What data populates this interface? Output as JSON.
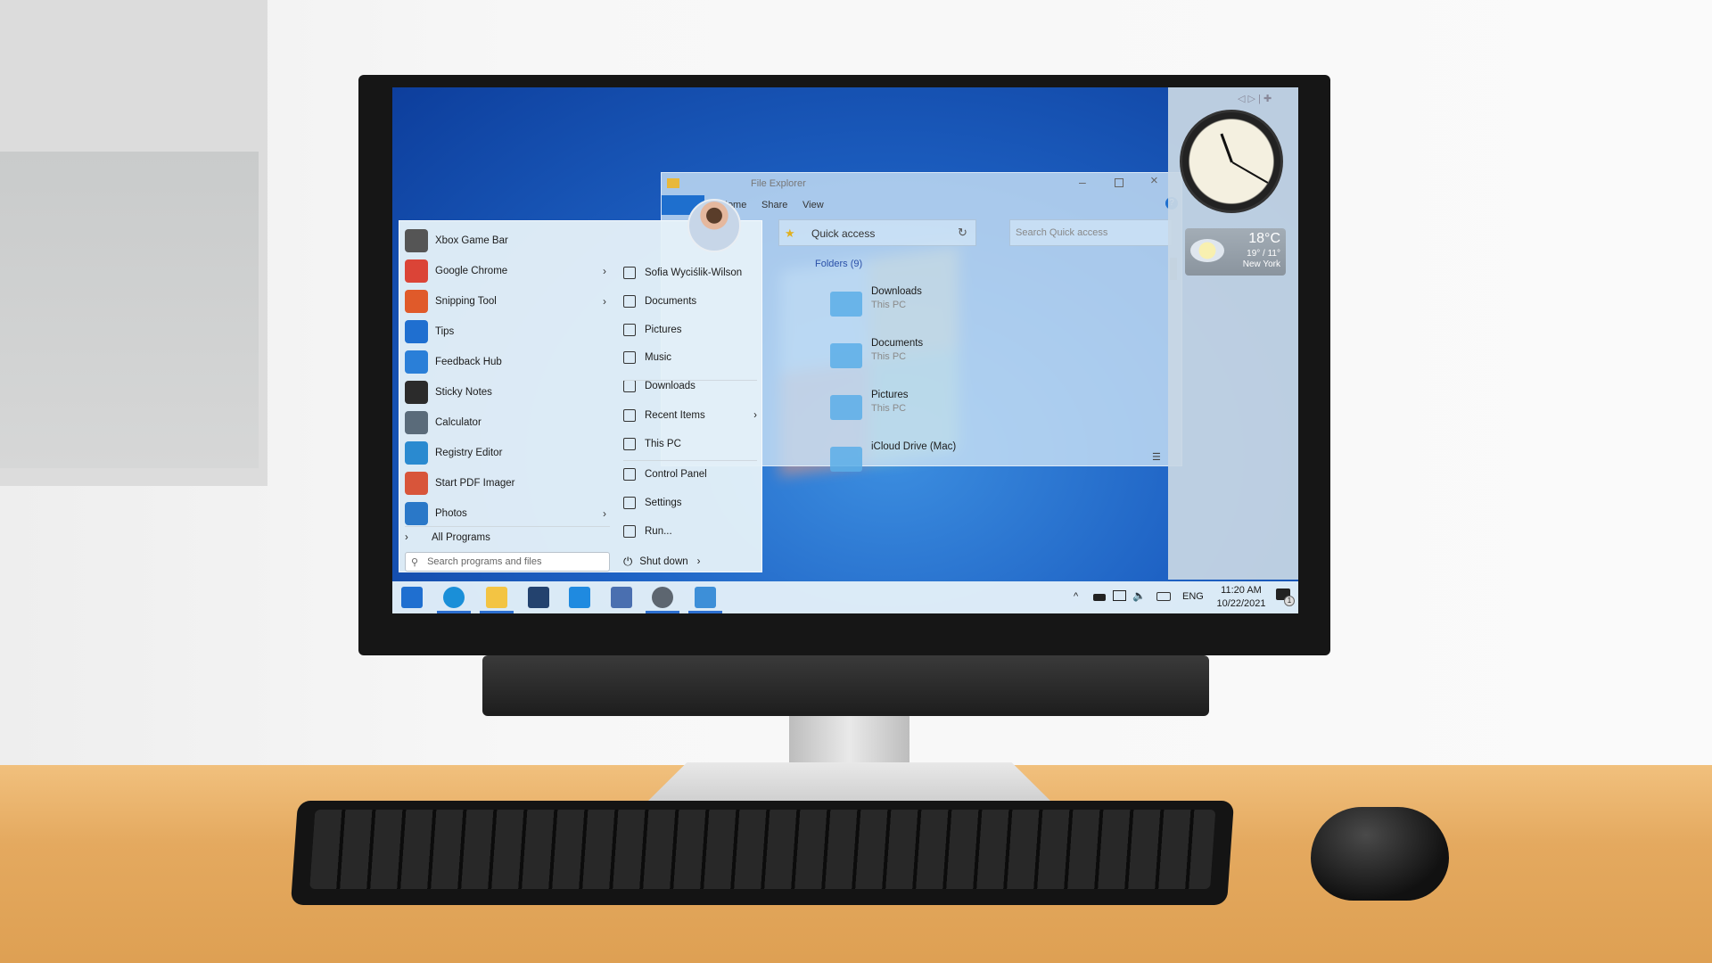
{
  "start_menu": {
    "items": [
      {
        "label": "Xbox Game Bar",
        "icon": "xbox-game-bar-icon",
        "submenu": false,
        "color": "#555555"
      },
      {
        "label": "Google Chrome",
        "icon": "chrome-icon",
        "submenu": true,
        "color": "#db4437"
      },
      {
        "label": "Snipping Tool",
        "icon": "snipping-tool-icon",
        "submenu": true,
        "color": "#e05a2a"
      },
      {
        "label": "Tips",
        "icon": "tips-icon",
        "submenu": false,
        "color": "#1f6fd0"
      },
      {
        "label": "Feedback Hub",
        "icon": "feedback-hub-icon",
        "submenu": false,
        "color": "#2a7fd8"
      },
      {
        "label": "Sticky Notes",
        "icon": "sticky-notes-icon",
        "submenu": false,
        "color": "#2b2b2b"
      },
      {
        "label": "Calculator",
        "icon": "calculator-icon",
        "submenu": false,
        "color": "#5a6b7a"
      },
      {
        "label": "Registry Editor",
        "icon": "registry-editor-icon",
        "submenu": false,
        "color": "#2a8ad0"
      },
      {
        "label": "Start PDF Imager",
        "icon": "pdf-imager-icon",
        "submenu": false,
        "color": "#d8553a"
      },
      {
        "label": "Photos",
        "icon": "photos-icon",
        "submenu": true,
        "color": "#2a78c8"
      }
    ],
    "all_programs": "All Programs",
    "search_placeholder": "Search programs and files",
    "right_items": [
      {
        "label": "Sofia Wyciślik-Wilson",
        "icon": "user-folder-icon"
      },
      {
        "label": "Documents",
        "icon": "document-icon"
      },
      {
        "label": "Pictures",
        "icon": "picture-icon"
      },
      {
        "label": "Music",
        "icon": "music-icon"
      },
      {
        "label": "Downloads",
        "icon": "download-icon"
      },
      {
        "label": "Recent Items",
        "icon": "clock-icon",
        "submenu": true
      },
      {
        "label": "This PC",
        "icon": "computer-icon"
      },
      {
        "label": "Control Panel",
        "icon": "control-panel-icon"
      },
      {
        "label": "Settings",
        "icon": "gear-icon"
      },
      {
        "label": "Run...",
        "icon": "run-icon"
      }
    ],
    "shutdown": "Shut down"
  },
  "explorer": {
    "title": "File Explorer",
    "tabs": [
      "Home",
      "Share",
      "View"
    ],
    "address": "Quick access",
    "search_placeholder": "Search Quick access",
    "group": "Folders (9)",
    "folders": [
      {
        "name": "Downloads",
        "sub": "This PC"
      },
      {
        "name": "Documents",
        "sub": "This PC"
      },
      {
        "name": "Pictures",
        "sub": "This PC"
      },
      {
        "name": "iCloud Drive (Mac)",
        "sub": ""
      }
    ]
  },
  "gadgets": {
    "clock_time": "11:20",
    "weather": {
      "temp": "18°C",
      "range": "19° / 11°",
      "city": "New York"
    }
  },
  "taskbar": {
    "apps": [
      {
        "name": "start",
        "color": "#1f6fd0",
        "active": false
      },
      {
        "name": "edge",
        "color": "#1a8fd8",
        "active": true
      },
      {
        "name": "file-explorer",
        "color": "#f3c443",
        "active": true
      },
      {
        "name": "store",
        "color": "#23426e",
        "active": false
      },
      {
        "name": "mail",
        "color": "#1f8ae0",
        "active": false
      },
      {
        "name": "paint",
        "color": "#4a6fb0",
        "active": false
      },
      {
        "name": "settings",
        "color": "#5d6670",
        "active": true
      },
      {
        "name": "control-panel",
        "color": "#3d8fd8",
        "active": true
      }
    ],
    "tray": {
      "language": "ENG",
      "time": "11:20 AM",
      "date": "10/22/2021",
      "notifications": "1"
    }
  }
}
